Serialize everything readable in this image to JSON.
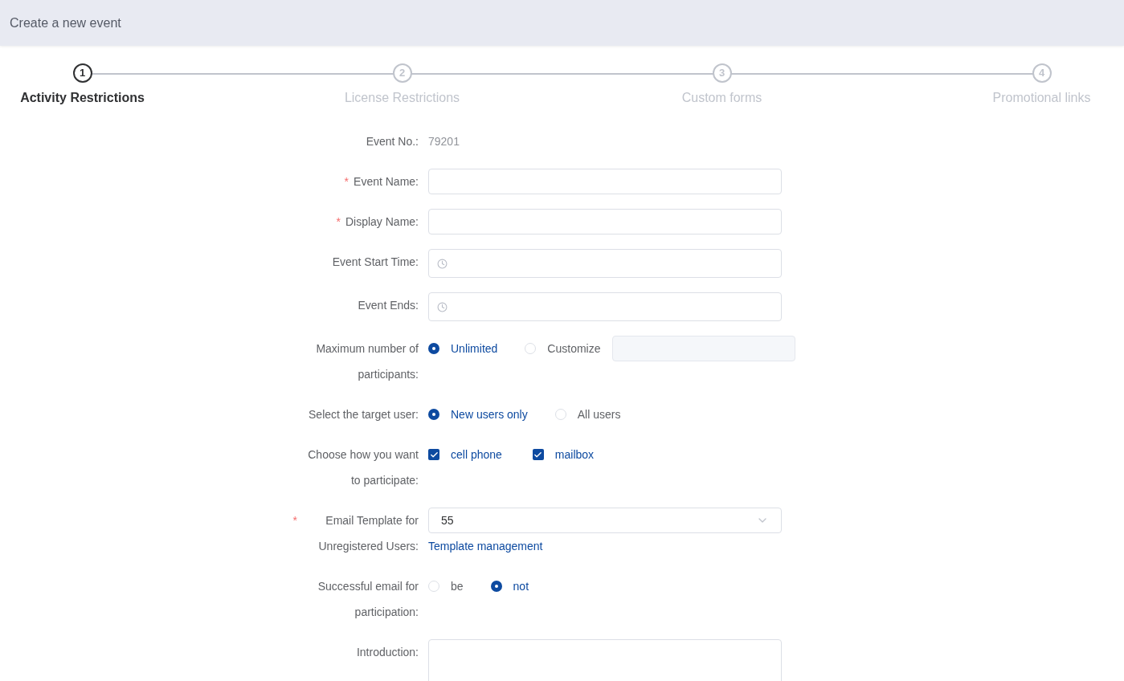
{
  "header": {
    "title": "Create a new event"
  },
  "steps": [
    {
      "number": "1",
      "label": "Activity Restrictions",
      "selected": true
    },
    {
      "number": "2",
      "label": "License Restrictions",
      "selected": false
    },
    {
      "number": "3",
      "label": "Custom forms",
      "selected": false
    },
    {
      "number": "4",
      "label": "Promotional links",
      "selected": false
    }
  ],
  "form": [
    {
      "kind": "text",
      "label": "Event No.:",
      "value": "79201"
    },
    {
      "kind": "input",
      "label": "Event Name:",
      "asterisk": "*"
    },
    {
      "kind": "input",
      "label": "Display Name:",
      "asterisk": "*"
    },
    {
      "kind": "time",
      "label": "Event Start Time:"
    },
    {
      "kind": "time",
      "label": "Event Ends:"
    },
    {
      "kind": "radio",
      "label": "Maximum number of participants:",
      "options": [
        {
          "label": "Unlimited",
          "selected": true
        },
        {
          "label": "Customize",
          "selected": false
        }
      ],
      "custom_field": {
        "disabled": true
      }
    },
    {
      "kind": "radio",
      "label": "Select the target user:",
      "options": [
        {
          "label": "New users only",
          "selected": true
        },
        {
          "label": "All users",
          "selected": false
        }
      ]
    },
    {
      "kind": "checkbox",
      "label": "Choose how you want to participate:",
      "options": [
        {
          "label": "cell phone",
          "checked": true
        },
        {
          "label": "mailbox",
          "checked": true
        }
      ]
    },
    {
      "kind": "select",
      "label": "Email Template for Unregistered Users:",
      "asterisk": "*",
      "value": "55",
      "link": "Template management"
    },
    {
      "kind": "radio",
      "label": "Successful email for participation:",
      "options": [
        {
          "label": "be",
          "selected": false
        },
        {
          "label": "not",
          "selected": true
        }
      ]
    },
    {
      "kind": "textarea",
      "label": "Introduction:"
    }
  ]
}
